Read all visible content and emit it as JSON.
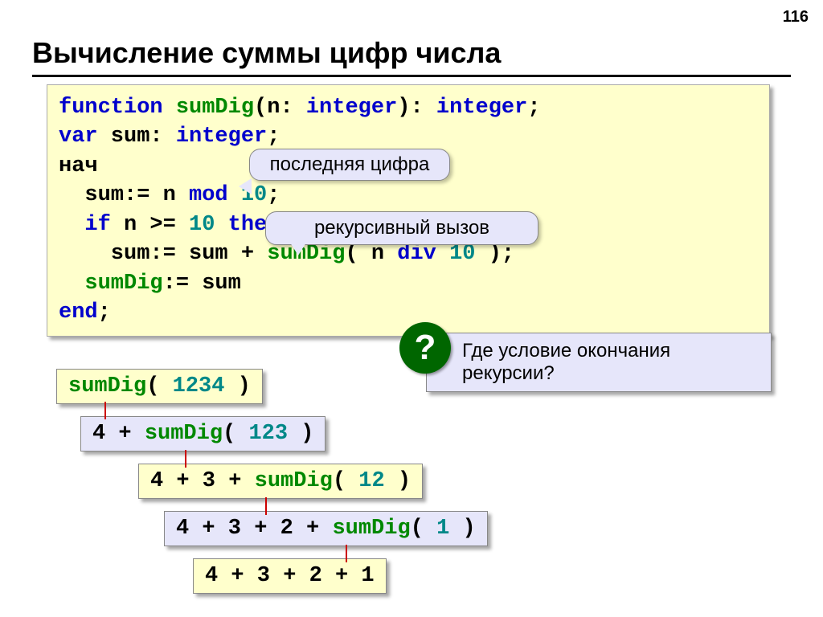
{
  "page_number": "116",
  "title": "Вычисление суммы цифр числа",
  "code": {
    "l1": {
      "function": "function",
      "name": " sumDig",
      "par1": "(n: ",
      "int1": "integer",
      "par2": "): ",
      "int2": "integer",
      "semi": ";"
    },
    "l2": {
      "var": "var",
      "sum": " sum: ",
      "int": "integer",
      "semi": ";"
    },
    "l3": "нач",
    "l4": {
      "pre": "  sum:= n ",
      "mod": "mod",
      "sp": " ",
      "ten": "10",
      "semi": ";"
    },
    "l5": {
      "pre": "  ",
      "if": "if",
      "mid": " n >= ",
      "ten": "10",
      "sp": " ",
      "then": "then"
    },
    "l6": {
      "pre": "    sum:= sum + ",
      "name": "sumDig",
      "par": "( n ",
      "div": "div",
      "sp": " ",
      "ten": "10",
      "close": " );"
    },
    "l7": {
      "pre": "  ",
      "name": "sumDig",
      "rest": ":= sum"
    },
    "l8": {
      "end": "end",
      "semi": ";"
    }
  },
  "callouts": {
    "last_digit": "последняя цифра",
    "recursive_call": "рекурсивный вызов"
  },
  "question": {
    "mark": "?",
    "text": "Где условие окончания рекурсии?"
  },
  "steps": {
    "s1": {
      "fn": "sumDig",
      "par": "( ",
      "num": "1234",
      "close": " )"
    },
    "s2": {
      "pre": "4 + ",
      "fn": "sumDig",
      "par": "( ",
      "num": "123",
      "close": " )"
    },
    "s3": {
      "pre": "4 + 3 + ",
      "fn": "sumDig",
      "par": "( ",
      "num": "12",
      "close": " )"
    },
    "s4": {
      "pre": "4 + 3 + 2 + ",
      "fn": "sumDig",
      "par": "( ",
      "num": "1",
      "close": " )"
    },
    "s5": "4 + 3 + 2 + 1"
  }
}
